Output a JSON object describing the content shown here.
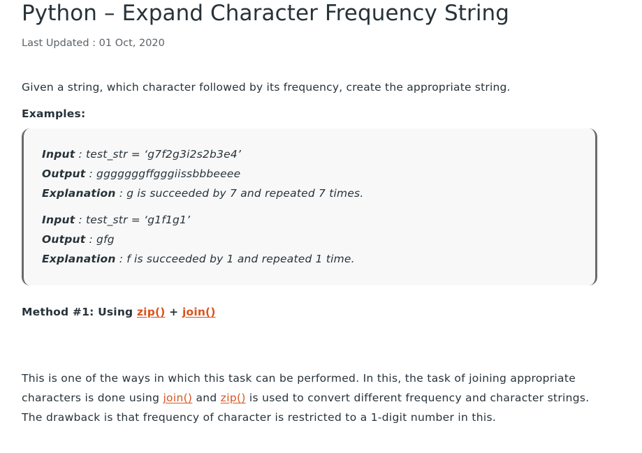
{
  "article": {
    "title": "Python – Expand Character Frequency String",
    "last_updated": "Last Updated : 01 Oct, 2020",
    "intro": "Given a string, which character followed by its frequency, create the appropriate string.",
    "examples_heading": "Examples:",
    "examples": [
      {
        "input_label": "Input",
        "input_value": " : test_str = ‘g7f2g3i2s2b3e4’",
        "output_label": "Output",
        "output_value": " : gggggggffgggiissbbbeeee",
        "explanation_label": "Explanation",
        "explanation_value": " : g is succeeded by 7 and repeated 7 times."
      },
      {
        "input_label": "Input",
        "input_value": " : test_str = ‘g1f1g1’",
        "output_label": "Output",
        "output_value": " : gfg",
        "explanation_label": "Explanation",
        "explanation_value": " : f is succeeded by 1 and repeated 1 time."
      }
    ],
    "method": {
      "prefix": "Method #1: Using ",
      "link1": "zip()",
      "joiner": " + ",
      "link2": "join()"
    },
    "paragraph": {
      "part1": "This is one of the ways in which this task can be performed. In this, the task of joining appropriate characters is done using ",
      "link1": "join()",
      "part2": " and ",
      "link2": "zip()",
      "part3": " is used to convert different frequency and character strings. The drawback is that frequency of character is restricted to a 1-digit number in this."
    }
  },
  "colors": {
    "text": "#273239",
    "link": "#d9541e",
    "box_background": "#f8f8f8",
    "box_border": "#6a6a6a"
  }
}
